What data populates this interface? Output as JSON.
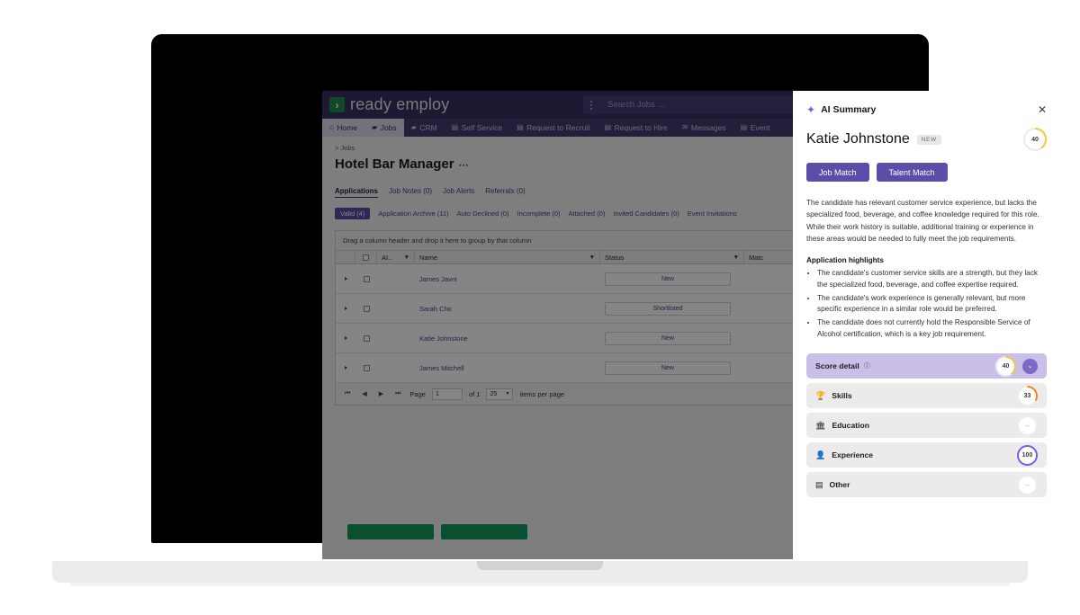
{
  "app": {
    "brand": "ready employ",
    "logo_glyph": "›",
    "logo_color": "#1e8f4e",
    "search_placeholder": "Search Jobs ...",
    "nav": [
      {
        "label": "Home",
        "icon": "home-icon",
        "glyph": "⌂",
        "active": false
      },
      {
        "label": "Jobs",
        "icon": "folder-icon",
        "glyph": "▰",
        "active": true
      },
      {
        "label": "CRM",
        "icon": "briefcase-icon",
        "glyph": "▰",
        "active": false
      },
      {
        "label": "Self Service",
        "icon": "card-icon",
        "glyph": "▤",
        "active": false
      },
      {
        "label": "Request to Recruit",
        "icon": "card-icon",
        "glyph": "▤",
        "active": false
      },
      {
        "label": "Request to Hire",
        "icon": "card-icon",
        "glyph": "▤",
        "active": false
      },
      {
        "label": "Messages",
        "icon": "envelope-icon",
        "glyph": "✉",
        "active": false
      },
      {
        "label": "Event",
        "icon": "card-icon",
        "glyph": "▤",
        "active": false
      }
    ]
  },
  "page": {
    "breadcrumb": "> Jobs",
    "title": "Hotel Bar Manager",
    "title_more": "⋯",
    "tabs": [
      {
        "label": "Applications",
        "active": true
      },
      {
        "label": "Job Notes (0)",
        "active": false
      },
      {
        "label": "Job Alerts",
        "active": false
      },
      {
        "label": "Referrals (0)",
        "active": false
      }
    ],
    "subtabs": [
      {
        "label": "Valid (4)",
        "active": true
      },
      {
        "label": "Application Archive (11)",
        "active": false
      },
      {
        "label": "Auto Declined (0)",
        "active": false
      },
      {
        "label": "Incomplete (0)",
        "active": false
      },
      {
        "label": "Attached (0)",
        "active": false
      },
      {
        "label": "Invited Candidates (0)",
        "active": false
      },
      {
        "label": "Event Invitations",
        "active": false
      }
    ]
  },
  "grid": {
    "group_hint": "Drag a column header and drop it here to group by that column",
    "columns": [
      "AI..",
      "Name",
      "Status",
      "Matc"
    ],
    "rows": [
      {
        "name": "James Javni",
        "status": "New"
      },
      {
        "name": "Sarah Cho",
        "status": "Shortlisted"
      },
      {
        "name": "Katie Johnstone",
        "status": "New"
      },
      {
        "name": "James Mitchell",
        "status": "New"
      }
    ],
    "pager": {
      "page_label": "Page",
      "page_value": "1",
      "of_label": "of 1",
      "per_page_value": "25",
      "per_page_label": "items per page"
    }
  },
  "ai_panel": {
    "title": "AI Summary",
    "spark_icon": "sparkle-icon",
    "close_icon": "close-icon",
    "candidate_name": "Katie Johnstone",
    "candidate_badge": "NEW",
    "overall_score": "40",
    "buttons": [
      {
        "label": "Job Match"
      },
      {
        "label": "Talent Match"
      }
    ],
    "summary": "The candidate has relevant customer service experience, but lacks the specialized food, beverage, and coffee knowledge required for this role. While their work history is suitable, additional training or experience in these areas would be needed to fully meet the job requirements.",
    "highlights_title": "Application highlights",
    "highlights": [
      "The candidate's customer service skills are a strength, but they lack the specialized food, beverage, and coffee expertise required.",
      "The candidate's work experience is generally relevant, but more specific experience in a similar role would be preferred.",
      "The candidate does not currently hold the Responsible Service of Alcohol certification, which is a key job requirement."
    ],
    "score_detail": {
      "label": "Score detail",
      "info_icon": "info-icon",
      "score": "40",
      "chevron_icon": "chevron-down-icon",
      "accent": "#c9bfe8"
    },
    "score_rows": [
      {
        "label": "Skills",
        "icon": "trophy-icon",
        "glyph": "🏆",
        "score": "33",
        "color": "#f0871e"
      },
      {
        "label": "Education",
        "icon": "bank-icon",
        "glyph": "🏛",
        "score": "–",
        "color": "#e4e4e4"
      },
      {
        "label": "Experience",
        "icon": "person-check-icon",
        "glyph": "👤",
        "score": "100",
        "color": "#7c5ce0"
      },
      {
        "label": "Other",
        "icon": "id-card-icon",
        "glyph": "▤",
        "score": "–",
        "color": "#e4e4e4"
      }
    ]
  },
  "footer_actions": [
    {
      "name": "primary-green-action"
    },
    {
      "name": "secondary-green-action"
    }
  ]
}
